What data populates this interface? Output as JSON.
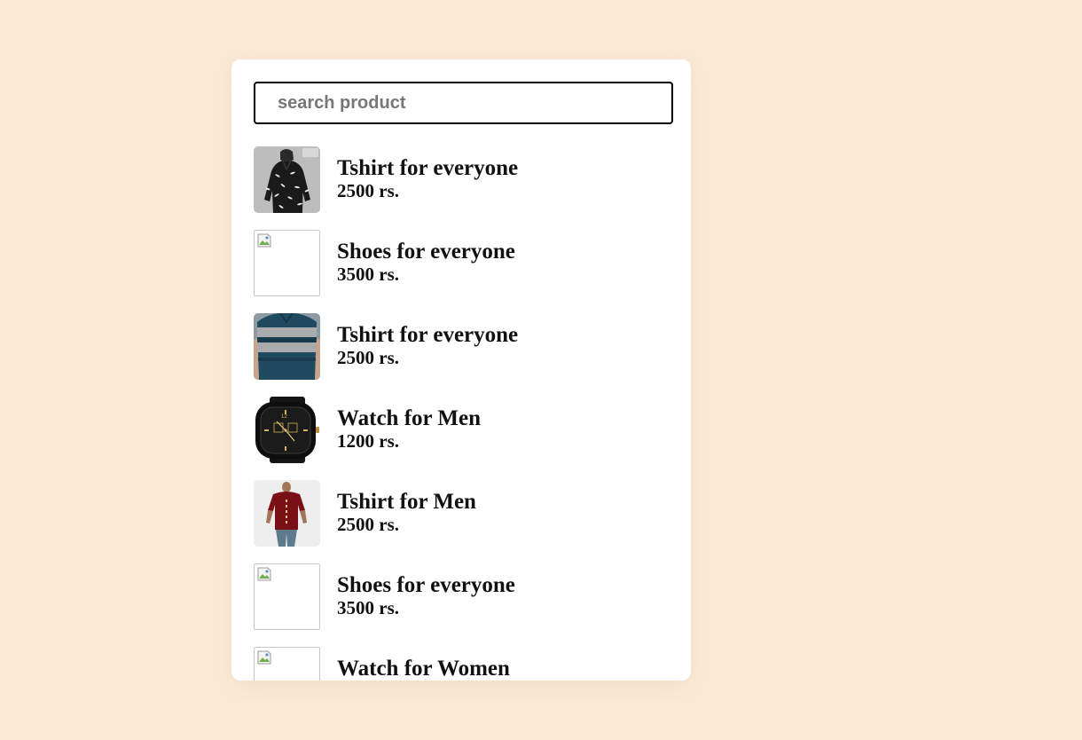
{
  "search": {
    "placeholder": "search product",
    "value": ""
  },
  "products": [
    {
      "name": "Tshirt for everyone",
      "price": "2500 rs.",
      "image": "black-printed-shirt"
    },
    {
      "name": "Shoes for everyone",
      "price": "3500 rs.",
      "image": "broken-image-icon"
    },
    {
      "name": "Tshirt for everyone",
      "price": "2500 rs.",
      "image": "striped-polo-tshirt"
    },
    {
      "name": "Watch for Men",
      "price": "1200 rs.",
      "image": "black-gold-watch"
    },
    {
      "name": "Tshirt for Men",
      "price": "2500 rs.",
      "image": "maroon-tshirt"
    },
    {
      "name": "Shoes for everyone",
      "price": "3500 rs.",
      "image": "broken-image-icon"
    },
    {
      "name": "Watch for Women",
      "price": "",
      "image": "broken-image-icon"
    }
  ],
  "colors": {
    "background": "#faead6",
    "card": "#ffffff",
    "text": "#111111"
  }
}
